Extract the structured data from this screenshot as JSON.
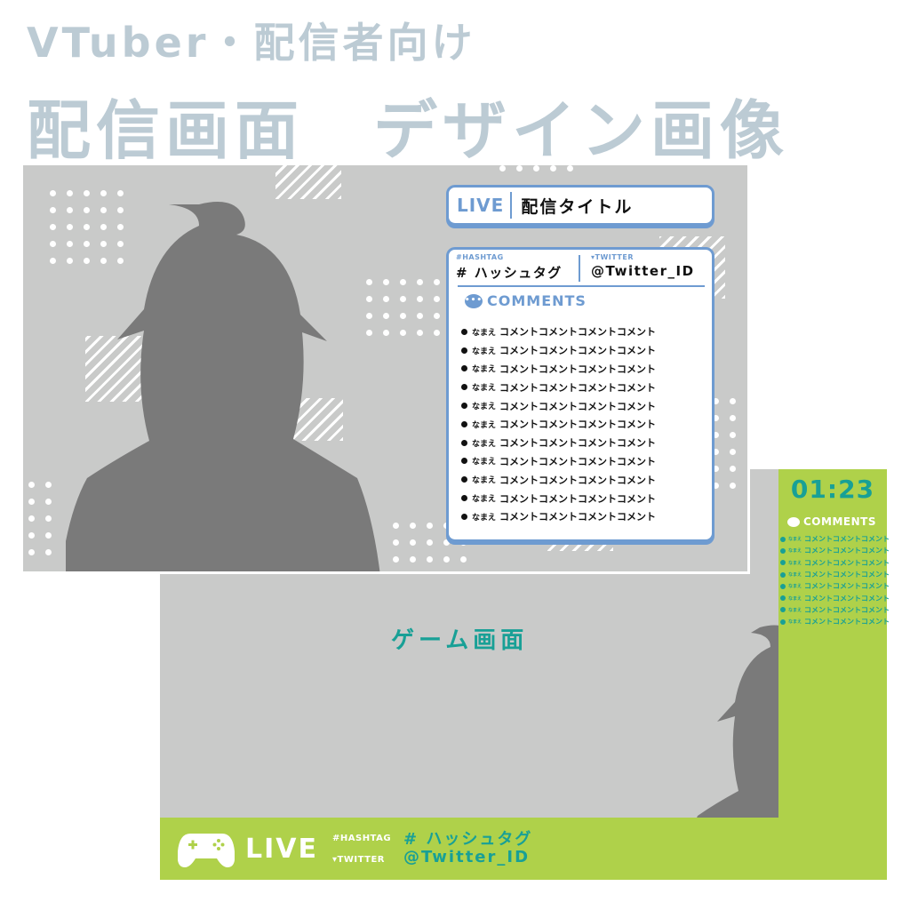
{
  "headline": {
    "line1": "VTuber・配信者向け",
    "line2": "配信画面　デザイン画像"
  },
  "colors": {
    "headline": "#bccbd4",
    "panel_bg": "#c9cac9",
    "silhouette": "#7a7a7a",
    "accent_blue": "#6e9bd1",
    "accent_green": "#afd14a",
    "accent_teal": "#18a096"
  },
  "top_screen": {
    "title_bar": {
      "live_label": "LIVE",
      "title": "配信タイトル"
    },
    "info": {
      "hashtag_label": "#HASHTAG",
      "hashtag_value": "# ハッシュタグ",
      "twitter_label": "TWITTER",
      "twitter_value": "@Twitter_ID",
      "twitter_icon": "bird-icon"
    },
    "comments": {
      "header": "COMMENTS",
      "icon": "speech-bubble-icon",
      "items": [
        {
          "name": "なまえ",
          "text": "コメントコメントコメントコメント"
        },
        {
          "name": "なまえ",
          "text": "コメントコメントコメントコメント"
        },
        {
          "name": "なまえ",
          "text": "コメントコメントコメントコメント"
        },
        {
          "name": "なまえ",
          "text": "コメントコメントコメントコメント"
        },
        {
          "name": "なまえ",
          "text": "コメントコメントコメントコメント"
        },
        {
          "name": "なまえ",
          "text": "コメントコメントコメントコメント"
        },
        {
          "name": "なまえ",
          "text": "コメントコメントコメントコメント"
        },
        {
          "name": "なまえ",
          "text": "コメントコメントコメントコメント"
        },
        {
          "name": "なまえ",
          "text": "コメントコメントコメントコメント"
        },
        {
          "name": "なまえ",
          "text": "コメントコメントコメントコメント"
        },
        {
          "name": "なまえ",
          "text": "コメントコメントコメントコメント"
        }
      ]
    }
  },
  "game_screen": {
    "game_label": "ゲーム画面",
    "timer": "01:23",
    "comments": {
      "header": "COMMENTS",
      "icon": "speech-bubble-icon",
      "items": [
        {
          "name": "なまえ",
          "text": "コメントコメントコメント"
        },
        {
          "name": "なまえ",
          "text": "コメントコメントコメント"
        },
        {
          "name": "なまえ",
          "text": "コメントコメントコメント"
        },
        {
          "name": "なまえ",
          "text": "コメントコメントコメント"
        },
        {
          "name": "なまえ",
          "text": "コメントコメントコメント"
        },
        {
          "name": "なまえ",
          "text": "コメントコメントコメント"
        },
        {
          "name": "なまえ",
          "text": "コメントコメントコメント"
        },
        {
          "name": "なまえ",
          "text": "コメントコメントコメント"
        }
      ]
    },
    "bottom_bar": {
      "icon": "gamepad-icon",
      "live_label": "LIVE",
      "hashtag_label": "#HASHTAG",
      "hashtag_value": "# ハッシュタグ",
      "twitter_label": "TWITTER",
      "twitter_value": "@Twitter_ID"
    }
  }
}
